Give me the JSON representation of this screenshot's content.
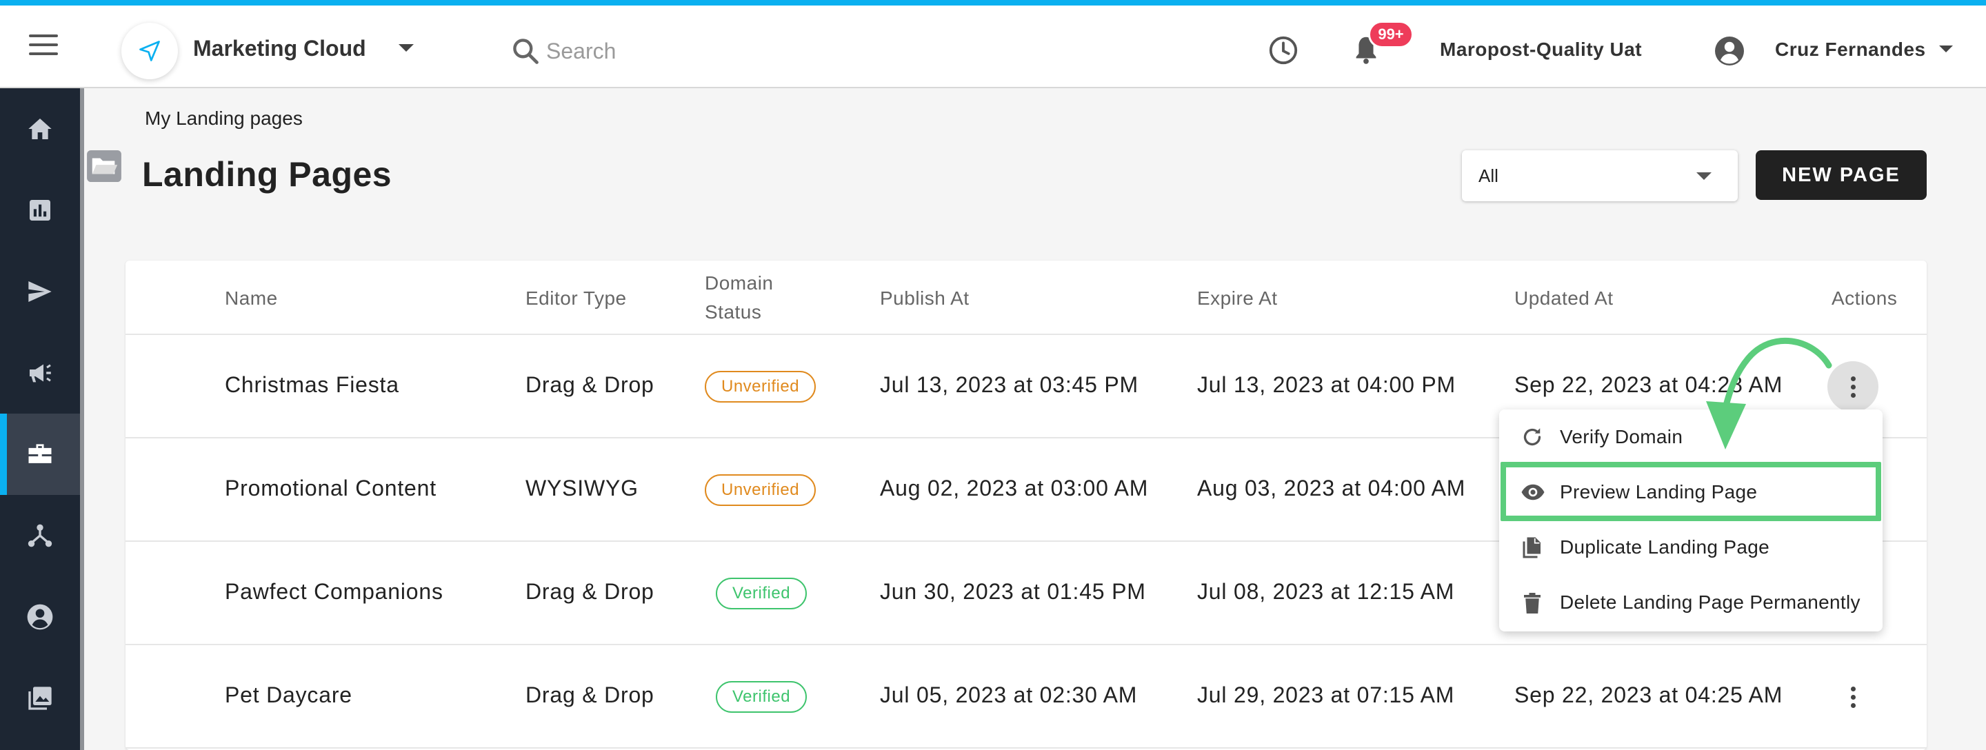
{
  "header": {
    "app_name": "Marketing Cloud",
    "search_placeholder": "Search",
    "notification_count": "99+",
    "account_name": "Maropost-Quality Uat",
    "user_name": "Cruz Fernandes"
  },
  "sidebar": {
    "items": [
      {
        "name": "home-icon"
      },
      {
        "name": "reports-icon"
      },
      {
        "name": "send-icon"
      },
      {
        "name": "campaign-icon"
      },
      {
        "name": "briefcase-icon",
        "active": true
      },
      {
        "name": "journey-icon"
      },
      {
        "name": "contacts-icon"
      },
      {
        "name": "gallery-icon"
      }
    ]
  },
  "breadcrumb": "My Landing pages",
  "page_title": "Landing Pages",
  "filter": {
    "value": "All"
  },
  "new_page_label": "NEW PAGE",
  "table": {
    "headers": {
      "name": "Name",
      "editor_type": "Editor Type",
      "domain_status_line1": "Domain",
      "domain_status_line2": "Status",
      "publish_at": "Publish At",
      "expire_at": "Expire At",
      "updated_at": "Updated At",
      "actions": "Actions"
    },
    "rows": [
      {
        "name": "Christmas Fiesta",
        "editor_type": "Drag & Drop",
        "domain_status": "Unverified",
        "publish_at": "Jul 13, 2023 at 03:45 PM",
        "expire_at": "Jul 13, 2023 at 04:00 PM",
        "updated_at": "Sep 22, 2023 at 04:28 AM"
      },
      {
        "name": "Promotional Content",
        "editor_type": "WYSIWYG",
        "domain_status": "Unverified",
        "publish_at": "Aug 02, 2023 at 03:00 AM",
        "expire_at": "Aug 03, 2023 at 04:00 AM",
        "updated_at": ""
      },
      {
        "name": "Pawfect Companions",
        "editor_type": "Drag & Drop",
        "domain_status": "Verified",
        "publish_at": "Jun 30, 2023 at 01:45 PM",
        "expire_at": "Jul 08, 2023 at 12:15 AM",
        "updated_at": ""
      },
      {
        "name": "Pet Daycare",
        "editor_type": "Drag & Drop",
        "domain_status": "Verified",
        "publish_at": "Jul 05, 2023 at 02:30 AM",
        "expire_at": "Jul 29, 2023 at 07:15 AM",
        "updated_at": "Sep 22, 2023 at 04:25 AM"
      }
    ]
  },
  "actions_menu": {
    "items": [
      {
        "label": "Verify Domain",
        "icon": "refresh-icon"
      },
      {
        "label": "Preview Landing Page",
        "icon": "eye-icon",
        "highlighted": true
      },
      {
        "label": "Duplicate Landing Page",
        "icon": "copy-icon"
      },
      {
        "label": "Delete Landing Page Permanently",
        "icon": "trash-icon"
      }
    ]
  },
  "colors": {
    "accent": "#0bb0f0",
    "sidebar": "#1d2633",
    "unverified": "#e08a1e",
    "verified": "#3ec46d",
    "highlight": "#5ccd7c",
    "badge": "#ee3c5a"
  }
}
